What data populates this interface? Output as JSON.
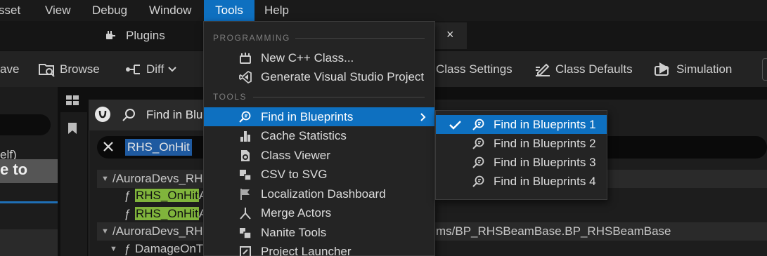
{
  "menubar": {
    "items": [
      {
        "label": "sset"
      },
      {
        "label": "View"
      },
      {
        "label": "Debug"
      },
      {
        "label": "Window"
      },
      {
        "label": "Tools"
      },
      {
        "label": "Help"
      }
    ]
  },
  "tabs": {
    "plugins": "Plugins",
    "close_glyph": "×"
  },
  "toolbar": {
    "save": "ave",
    "browse": "Browse",
    "diff": "Diff",
    "class_settings": "Class Settings",
    "class_defaults": "Class Defaults",
    "simulation": "Simulation"
  },
  "left_panel": {
    "self_text": "elf)",
    "big_text": "e to"
  },
  "find_window": {
    "title": "Find in Blu",
    "search_value": "RHS_OnHit",
    "results": [
      {
        "text": "/AuroraDevs_RH"
      },
      {
        "prefix": "ƒ",
        "highlight": "RHS_OnHit",
        "suffix": "A"
      },
      {
        "prefix": "ƒ",
        "highlight": "RHS_OnHit",
        "suffix": "A"
      },
      {
        "text": "/AuroraDevs_RH",
        "right": "ms/BP_RHSBeamBase.BP_RHSBeamBase"
      },
      {
        "prefix": "ƒ",
        "text": "DamageOnT"
      }
    ]
  },
  "tools_menu": {
    "sections": [
      {
        "header": "PROGRAMMING",
        "items": [
          {
            "label": "New C++ Class...",
            "icon": "cpp-class-icon"
          },
          {
            "label": "Generate Visual Studio Project",
            "icon": "visual-studio-icon"
          }
        ]
      },
      {
        "header": "TOOLS",
        "items": [
          {
            "label": "Find in Blueprints",
            "icon": "find-blueprints-icon",
            "submenu": true
          },
          {
            "label": "Cache Statistics",
            "icon": "bar-chart-icon"
          },
          {
            "label": "Class Viewer",
            "icon": "class-viewer-icon"
          },
          {
            "label": "CSV to SVG",
            "icon": "csv-svg-icon"
          },
          {
            "label": "Localization Dashboard",
            "icon": "flag-icon"
          },
          {
            "label": "Merge Actors",
            "icon": "merge-icon"
          },
          {
            "label": "Nanite Tools",
            "icon": "nanite-icon"
          },
          {
            "label": "Project Launcher",
            "icon": "launcher-icon"
          }
        ]
      }
    ]
  },
  "find_submenu": {
    "items": [
      {
        "label": "Find in Blueprints 1",
        "checked": true
      },
      {
        "label": "Find in Blueprints 2",
        "checked": false
      },
      {
        "label": "Find in Blueprints 3",
        "checked": false
      },
      {
        "label": "Find in Blueprints 4",
        "checked": false
      }
    ]
  },
  "colors": {
    "accent": "#0e70c0",
    "highlight": "#80b43c",
    "menu_bg": "#242424"
  }
}
